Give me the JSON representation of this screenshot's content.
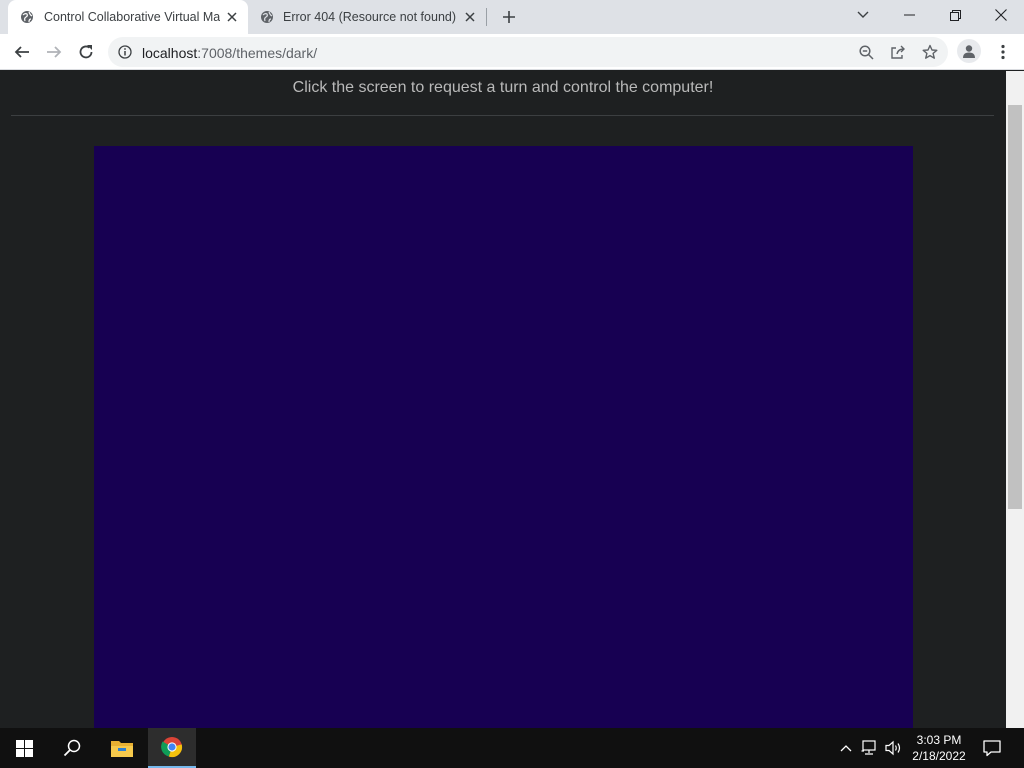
{
  "browser": {
    "tabs": [
      {
        "title": "Control Collaborative Virtual Machine",
        "active": true,
        "favicon": "globe-icon"
      },
      {
        "title": "Error 404 (Resource not found)",
        "active": false,
        "favicon": "globe-icon"
      }
    ],
    "url": {
      "host": "localhost",
      "rest": ":7008/themes/dark/"
    }
  },
  "page": {
    "banner": "Click the screen to request a turn and control the computer!",
    "vm_screen_color": "#170052",
    "background_color": "#1e2021"
  },
  "taskbar": {
    "time": "3:03 PM",
    "date": "2/18/2022",
    "apps": [
      "windows-start-icon",
      "search-icon",
      "file-explorer-icon",
      "chrome-icon"
    ]
  }
}
